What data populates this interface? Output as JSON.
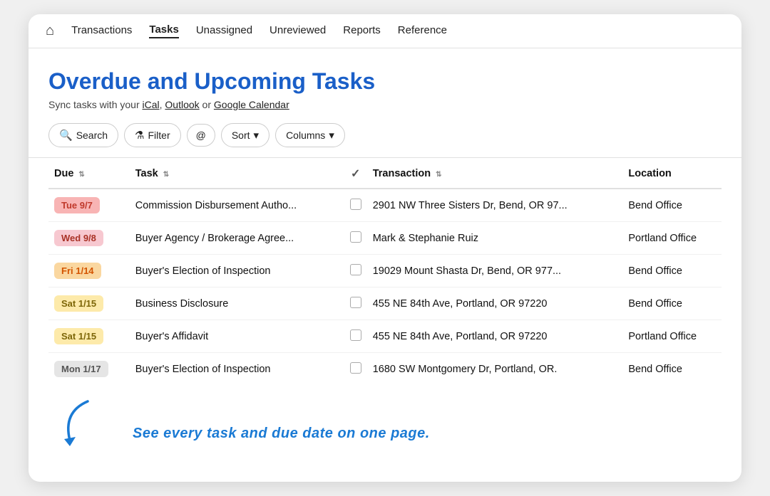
{
  "nav": {
    "home_icon": "⌂",
    "items": [
      {
        "label": "Transactions",
        "active": false
      },
      {
        "label": "Tasks",
        "active": true
      },
      {
        "label": "Unassigned",
        "active": false
      },
      {
        "label": "Unreviewed",
        "active": false
      },
      {
        "label": "Reports",
        "active": false
      },
      {
        "label": "Reference",
        "active": false
      }
    ]
  },
  "header": {
    "title": "Overdue and Upcoming Tasks",
    "sync_prefix": "Sync tasks with your ",
    "sync_ical": "iCal",
    "sync_sep1": ", ",
    "sync_outlook": "Outlook",
    "sync_sep2": " or ",
    "sync_gcal": "Google Calendar"
  },
  "toolbar": {
    "search_label": "Search",
    "filter_label": "Filter",
    "at_icon": "@",
    "sort_label": "Sort",
    "columns_label": "Columns"
  },
  "table": {
    "columns": [
      {
        "label": "Due",
        "sortable": true
      },
      {
        "label": "Task",
        "sortable": true
      },
      {
        "label": "✓",
        "sortable": false,
        "check": true
      },
      {
        "label": "Transaction",
        "sortable": true
      },
      {
        "label": "Location",
        "sortable": false
      }
    ],
    "rows": [
      {
        "due": "Tue 9/7",
        "due_class": "badge-red",
        "task": "Commission Disbursement Autho...",
        "transaction": "2901 NW Three Sisters Dr, Bend, OR 97...",
        "location": "Bend Office"
      },
      {
        "due": "Wed 9/8",
        "due_class": "badge-pink",
        "task": "Buyer Agency / Brokerage Agree...",
        "transaction": "Mark & Stephanie Ruiz",
        "location": "Portland Office"
      },
      {
        "due": "Fri 1/14",
        "due_class": "badge-orange",
        "task": "Buyer's Election of Inspection",
        "transaction": "19029 Mount Shasta Dr, Bend, OR 977...",
        "location": "Bend Office"
      },
      {
        "due": "Sat 1/15",
        "due_class": "badge-yellow",
        "task": "Business Disclosure",
        "transaction": "455 NE 84th Ave, Portland, OR 97220",
        "location": "Bend Office"
      },
      {
        "due": "Sat 1/15",
        "due_class": "badge-yellow",
        "task": "Buyer's Affidavit",
        "transaction": "455 NE 84th Ave, Portland, OR 97220",
        "location": "Portland Office"
      },
      {
        "due": "Mon 1/17",
        "due_class": "badge-gray",
        "task": "Buyer's Election of Inspection",
        "transaction": "1680 SW Montgomery Dr, Portland, OR.",
        "location": "Bend Office"
      }
    ]
  },
  "annotation": {
    "text": "See every task and due date on one page."
  }
}
